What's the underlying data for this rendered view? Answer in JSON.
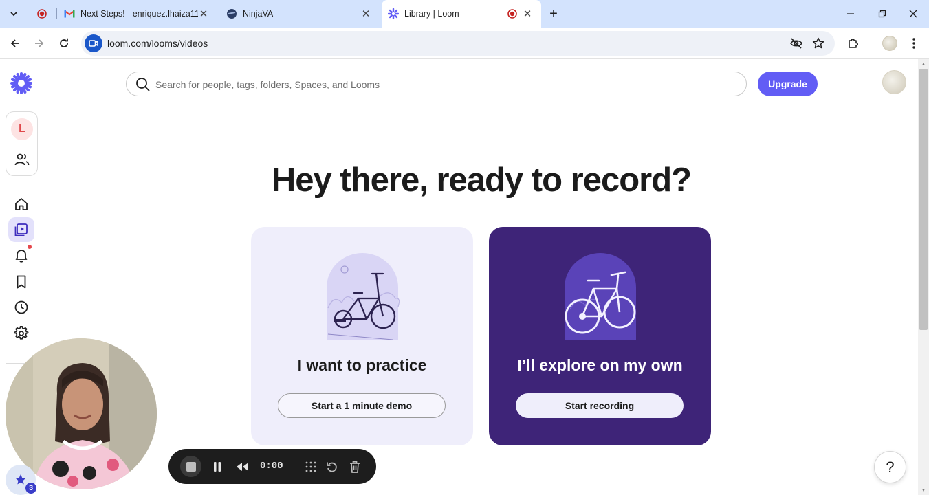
{
  "browser": {
    "tabs": [
      {
        "title": "",
        "recording": true
      },
      {
        "title": "Next Steps! - enriquez.lhaiza11",
        "favicon": "gmail-icon"
      },
      {
        "title": "NinjaVA",
        "favicon": "ninjava-icon"
      },
      {
        "title": "Library | Loom",
        "favicon": "loom-icon",
        "active": true,
        "recording": true
      }
    ],
    "new_tab_label": "+",
    "url": "loom.com/looms/videos"
  },
  "search": {
    "placeholder": "Search for people, tags, folders, Spaces, and Looms"
  },
  "header": {
    "upgrade_label": "Upgrade"
  },
  "workspace": {
    "initial": "L"
  },
  "main": {
    "heading": "Hey there, ready to record?"
  },
  "cards": [
    {
      "title": "I want to practice",
      "button": "Start a 1 minute demo"
    },
    {
      "title": "I’ll explore on my own",
      "button": "Start recording"
    }
  ],
  "recorder": {
    "time": "0:00"
  },
  "camera": {
    "badge_count": "3"
  },
  "help": {
    "label": "?"
  },
  "colors": {
    "accent": "#625df5",
    "explore_card": "#3e2478",
    "practice_card": "#efeefb",
    "tabbar": "#d3e3fd"
  }
}
